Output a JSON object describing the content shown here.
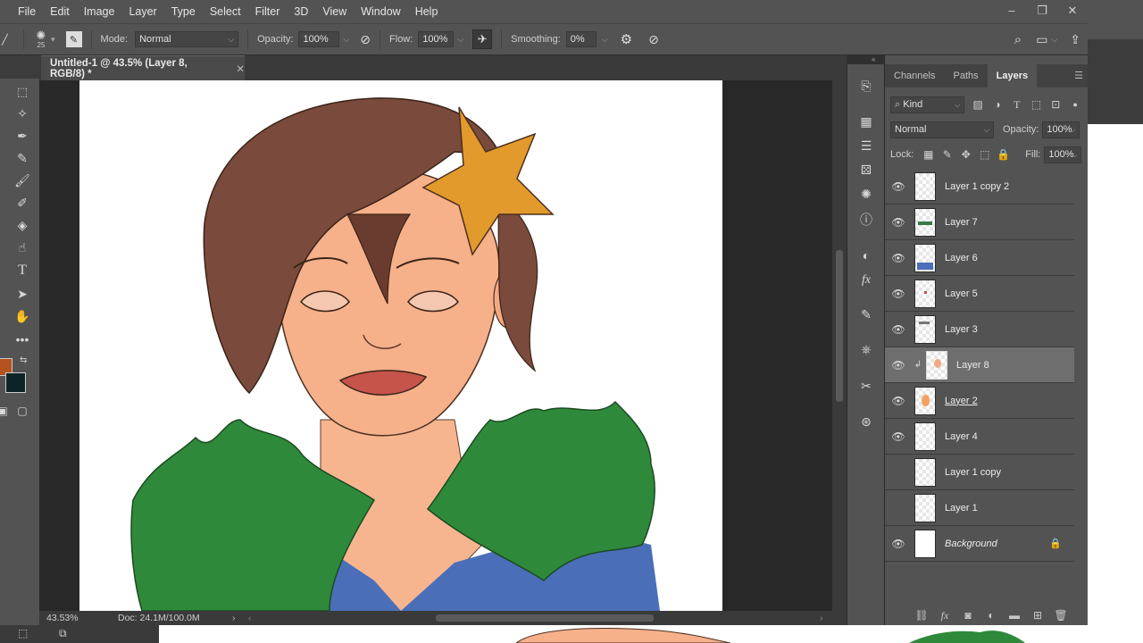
{
  "menubar": {
    "items": [
      "File",
      "Edit",
      "Image",
      "Layer",
      "Type",
      "Select",
      "Filter",
      "3D",
      "View",
      "Window",
      "Help"
    ],
    "window_controls": [
      "minimize-icon",
      "restore-icon",
      "close-icon"
    ]
  },
  "options_bar": {
    "brush_size": "25",
    "mode_label": "Mode:",
    "mode_value": "Normal",
    "opacity_label": "Opacity:",
    "opacity_value": "100%",
    "flow_label": "Flow:",
    "flow_value": "100%",
    "smoothing_label": "Smoothing:",
    "smoothing_value": "0%"
  },
  "document": {
    "tab_title": "Untitled-1 @ 43.5% (Layer 8, RGB/8) *",
    "zoom": "43.53%",
    "doc_info": "Doc: 24.1M/100.0M"
  },
  "colors": {
    "foreground": "#b5501f",
    "background": "#0e2424"
  },
  "layers_panel": {
    "tabs": [
      "Channels",
      "Paths",
      "Layers"
    ],
    "active_tab": "Layers",
    "filter_kind": "Kind",
    "blend_mode": "Normal",
    "opacity_label": "Opacity:",
    "opacity_value": "100%",
    "lock_label": "Lock:",
    "fill_label": "Fill:",
    "fill_value": "100%",
    "layers": [
      {
        "name": "Layer 1 copy 2",
        "visible": true
      },
      {
        "name": "Layer 7",
        "visible": true
      },
      {
        "name": "Layer 6",
        "visible": true
      },
      {
        "name": "Layer 5",
        "visible": true
      },
      {
        "name": "Layer 3",
        "visible": true
      },
      {
        "name": "Layer 8",
        "visible": true,
        "selected": true,
        "clipped": true
      },
      {
        "name": "Layer 2",
        "visible": true
      },
      {
        "name": "Layer 4",
        "visible": true
      },
      {
        "name": "Layer 1 copy",
        "visible": false
      },
      {
        "name": "Layer 1",
        "visible": false
      },
      {
        "name": "Background",
        "visible": true,
        "locked": true
      }
    ]
  }
}
